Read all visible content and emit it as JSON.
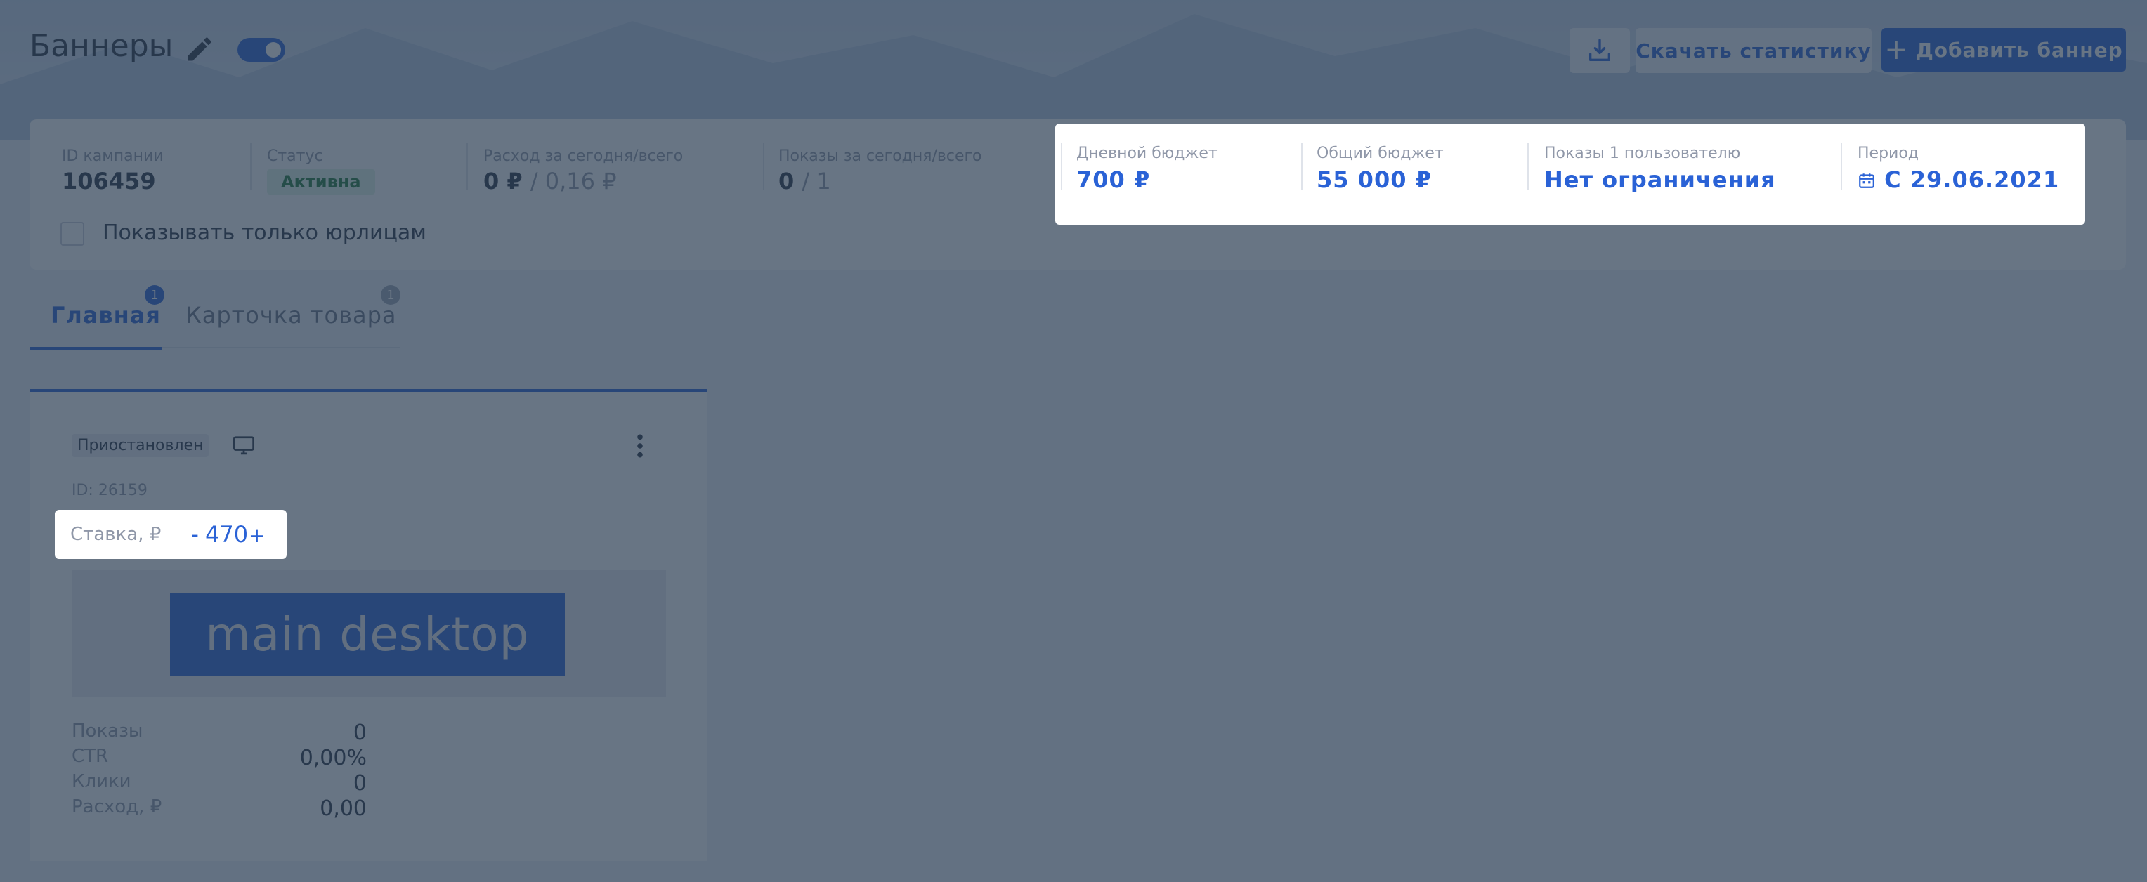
{
  "header": {
    "title": "Баннеры",
    "download_stats": "Скачать статистику",
    "add_banner": "Добавить баннер"
  },
  "campaign": {
    "id_label": "ID кампании",
    "id_value": "106459",
    "status_label": "Статус",
    "status_value": "Активна",
    "spend_label": "Расход за сегодня/всего",
    "spend_today": "0 ₽",
    "spend_total": "/ 0,16 ₽",
    "shows_label": "Показы за сегодня/всего",
    "shows_today": "0",
    "shows_total": "/ 1",
    "daily_budget_label": "Дневной бюджет",
    "daily_budget_value": "700 ₽",
    "total_budget_label": "Общий бюджет",
    "total_budget_value": "55 000 ₽",
    "per_user_label": "Показы 1 пользователю",
    "per_user_value": "Нет ограничения",
    "period_label": "Период",
    "period_value": "С 29.06.2021",
    "checkbox_label": "Показывать только юрлицам"
  },
  "tabs": [
    {
      "label": "Главная",
      "count": "1",
      "active": true
    },
    {
      "label": "Карточка товара",
      "count": "1",
      "active": false
    }
  ],
  "banner": {
    "state": "Приостановлен",
    "id_text": "ID: 26159",
    "rate_label": "Ставка, ₽",
    "rate_minus": "-",
    "rate_value": "470",
    "rate_plus": "+",
    "preview_text": "main desktop",
    "stats": [
      {
        "label": "Показы",
        "value": "0"
      },
      {
        "label": "CTR",
        "value": "0,00%"
      },
      {
        "label": "Клики",
        "value": "0"
      },
      {
        "label": "Расход, ₽",
        "value": "0,00"
      }
    ]
  },
  "colors": {
    "accent": "#2a62d6",
    "overlay": "rgba(40,58,80,0.70)"
  },
  "icons": [
    "edit-icon",
    "download-icon",
    "plus-icon",
    "calendar-icon",
    "monitor-icon",
    "kebab-menu-icon"
  ]
}
